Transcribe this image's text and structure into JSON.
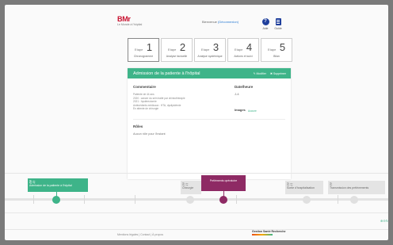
{
  "header": {
    "logo_text": "BMr",
    "logo_sub": "Le Monde à l'hôpital",
    "welcome_text": "Bienvenue",
    "welcome_link": "(Déconnexion)",
    "help_label": "Aide",
    "doc_label": "Guide"
  },
  "steps": [
    {
      "prefix": "Etape",
      "number": "1",
      "label": "Chronogramme"
    },
    {
      "prefix": "Etape",
      "number": "2",
      "label": "Analyse factuelle"
    },
    {
      "prefix": "Etape",
      "number": "3",
      "label": "Analyse systémique"
    },
    {
      "prefix": "Etape",
      "number": "4",
      "label": "Actions et suivi"
    },
    {
      "prefix": "Etape",
      "number": "5",
      "label": "Bilan"
    }
  ],
  "card": {
    "title": "Admission de la patiente à l'hôpital",
    "edit_label": "✎ Modifier",
    "delete_label": "✖ Supprimer",
    "comment_title": "Commentaire",
    "comment_lines": [
      "Patiente de 44 ans",
      "2020 : cancer du sein traité par chimiothérapie",
      "2021 : hystérectomie",
      "Antécédents médicaux : HTA, dyslipidémie",
      "En attente de chirurgie"
    ],
    "datetime_title": "Date/heure",
    "datetime_value": "J-4",
    "images_label": "Images",
    "images_value": "Aucune",
    "role_title": "Rôles",
    "role_value": "Aucun rôle pour l'instant"
  },
  "timeline": {
    "events": [
      {
        "icons": "⎘  ⇆",
        "label": "Admission de la patiente à l'hôpital",
        "style": "green"
      },
      {
        "icons": "⎘  ⇆",
        "label": "Chirurgie",
        "style": "gray"
      },
      {
        "icons": "",
        "label": "Préléments opératoire",
        "style": "purple"
      },
      {
        "icons": "⎘  ⇆",
        "label": "Sortie d'hospitalisation",
        "style": "gray"
      },
      {
        "icons": "⎘",
        "label": "Transmission des prélèvements",
        "style": "gray"
      }
    ],
    "zoom_label": "⊕⊖↻"
  },
  "footer": {
    "left_text": "Mentions légales  |  Contact  |  À propos",
    "logo_text": "Gestion Santé Recherche"
  },
  "colors": {
    "accent": "#3eb489",
    "selected_event": "#8e2a64",
    "brand_blue": "#1f3f9c",
    "logo_red": "#c8102e"
  }
}
